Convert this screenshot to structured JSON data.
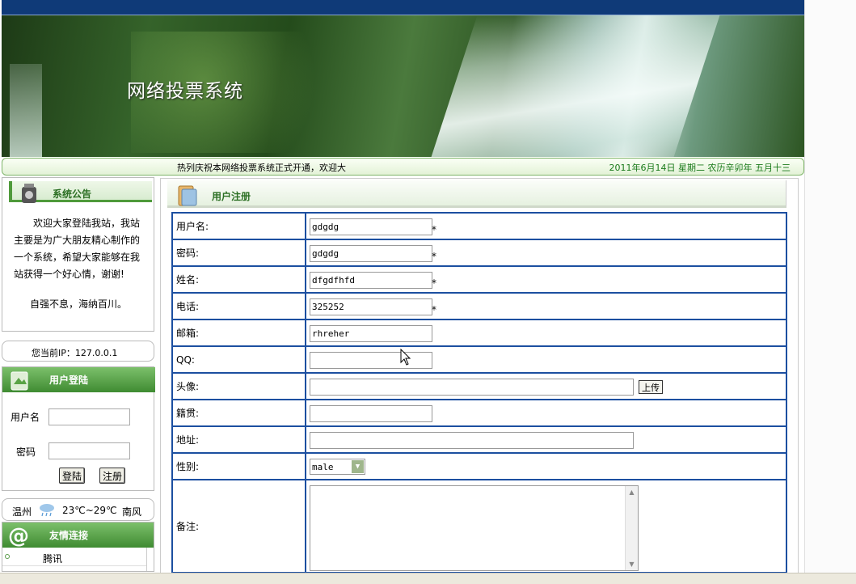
{
  "banner": {
    "title": "网络投票系统"
  },
  "marquee": {
    "message": "热列庆祝本网络投票系统正式开通，欢迎大",
    "date": "2011年6月14日 星期二 农历辛卯年 五月十三"
  },
  "notice": {
    "title": "系统公告",
    "text": "欢迎大家登陆我站，我站主要是为广大朋友精心制作的一个系统，希望大家能够在我站获得一个好心情，谢谢!",
    "text2": "自强不息，海纳百川。"
  },
  "ip": {
    "text": "您当前IP：127.0.0.1"
  },
  "login": {
    "title": "用户登陆",
    "username_label": "用户名",
    "password_label": "密码",
    "login_btn": "登陆",
    "register_btn": "注册"
  },
  "weather": {
    "city": "温州",
    "temp": "23℃~29℃",
    "wind": "南风",
    "icon": "cloud-rain-icon"
  },
  "links": {
    "title": "友情连接",
    "items": [
      "腾讯"
    ]
  },
  "register": {
    "title": "用户注册",
    "fields": [
      {
        "label": "用户名:",
        "value": "gdgdg",
        "required": "*"
      },
      {
        "label": "密码:",
        "value": "gdgdg",
        "required": "*"
      },
      {
        "label": "姓名:",
        "value": "dfgdfhfd",
        "required": "*"
      },
      {
        "label": "电话:",
        "value": "325252",
        "required": "*"
      },
      {
        "label": "邮箱:",
        "value": "rhreher",
        "required": ""
      },
      {
        "label": "QQ:",
        "value": "",
        "required": ""
      },
      {
        "label": "头像:",
        "value": "",
        "required": ""
      },
      {
        "label": "籍贯:",
        "value": "",
        "required": ""
      },
      {
        "label": "地址:",
        "value": "",
        "required": ""
      },
      {
        "label": "性别:",
        "value": "male",
        "required": ""
      },
      {
        "label": "备注:",
        "value": "",
        "required": ""
      }
    ],
    "upload_btn": "上传"
  },
  "colors": {
    "nav": "#0f3a78",
    "accent_green": "#3f8b32",
    "table_border": "#1c4fa0"
  }
}
